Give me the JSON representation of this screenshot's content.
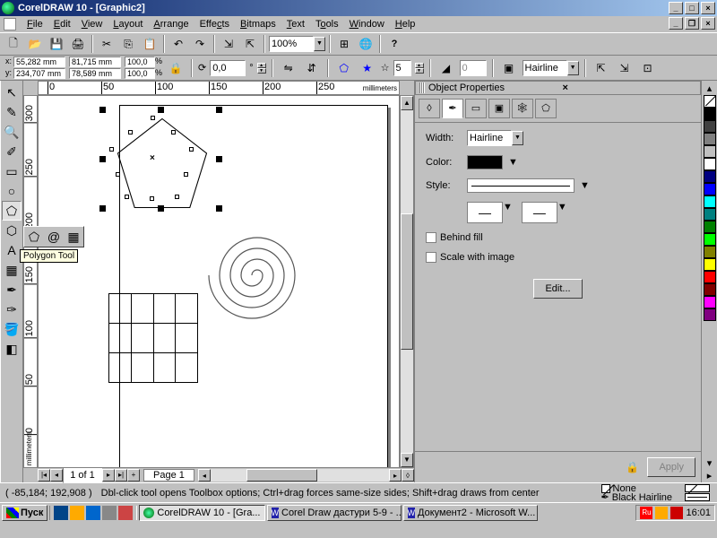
{
  "title": "CorelDRAW 10 - [Graphic2]",
  "menu": [
    "File",
    "Edit",
    "View",
    "Layout",
    "Arrange",
    "Effects",
    "Bitmaps",
    "Text",
    "Tools",
    "Window",
    "Help"
  ],
  "zoom": "100%",
  "coords": {
    "x_lbl": "x:",
    "y_lbl": "y:",
    "x": "55,282 mm",
    "y": "234,707 mm",
    "w": "81,715 mm",
    "h": "78,589 mm",
    "sx": "100,0",
    "sy": "100,0",
    "rot": "0,0",
    "points": "5",
    "hair": "Hairline"
  },
  "ruler_unit": "millimeters",
  "hruler": [
    "0",
    "50",
    "100",
    "150",
    "200",
    "250"
  ],
  "vruler": [
    "300",
    "250",
    "200",
    "150",
    "100",
    "50",
    "0"
  ],
  "tooltip": "Polygon Tool",
  "page_nav": {
    "info": "1 of 1",
    "tab": "Page 1"
  },
  "panel": {
    "title": "Object Properties",
    "width_lbl": "Width:",
    "width_val": "Hairline",
    "color_lbl": "Color:",
    "style_lbl": "Style:",
    "behind": "Behind fill",
    "scale": "Scale with image",
    "edit": "Edit...",
    "apply": "Apply"
  },
  "status": {
    "coords": "( -85,184; 192,908 )",
    "hint": "Dbl-click tool opens Toolbox options; Ctrl+drag forces same-size sides; Shift+drag draws from center",
    "fill": "None",
    "outline": "Black  Hairline"
  },
  "palette": [
    "#000000",
    "#404040",
    "#808080",
    "#c0c0c0",
    "#ffffff",
    "#000080",
    "#0000ff",
    "#008080",
    "#00ffff",
    "#008000",
    "#00ff00",
    "#808000",
    "#ffff00",
    "#800000",
    "#ff0000",
    "#800080",
    "#ff00ff"
  ],
  "taskbar": {
    "start": "Пуск",
    "tasks": [
      "CorelDRAW 10 - [Gra...",
      "Corel Draw дастури 5-9 - ...",
      "Документ2 - Microsoft W..."
    ],
    "lang": "Ru",
    "clock": "16:01"
  }
}
